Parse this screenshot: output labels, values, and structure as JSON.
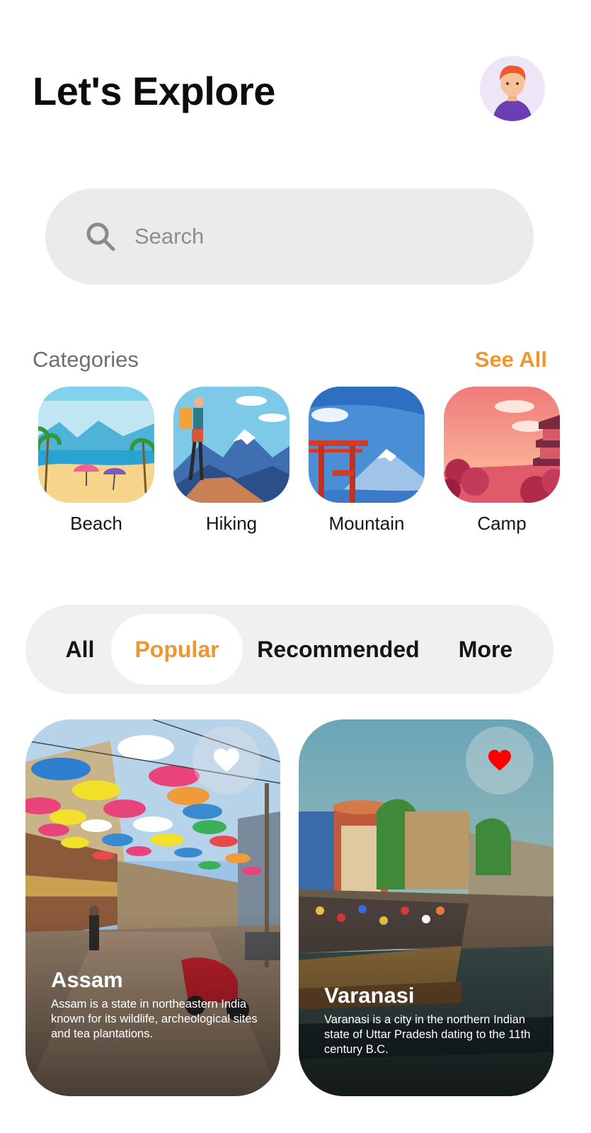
{
  "header": {
    "title": "Let's Explore",
    "avatar_icon": "user-avatar-icon"
  },
  "search": {
    "placeholder": "Search",
    "value": ""
  },
  "categories": {
    "heading": "Categories",
    "see_all": "See All",
    "items": [
      {
        "label": "Beach"
      },
      {
        "label": "Hiking"
      },
      {
        "label": "Mountain"
      },
      {
        "label": "Camp"
      }
    ]
  },
  "tabs": {
    "items": [
      {
        "label": "All"
      },
      {
        "label": "Popular"
      },
      {
        "label": "Recommended"
      },
      {
        "label": "More"
      }
    ],
    "active": "Popular"
  },
  "places": [
    {
      "name": "Assam",
      "description": "Assam is a state in northeastern India known for its wildlife, archeological sites and tea plantations.",
      "favorited": false
    },
    {
      "name": "Varanasi",
      "description": "Varanasi is a city in the northern Indian state of Uttar Pradesh dating to the 11th century B.C.",
      "favorited": true
    }
  ],
  "colors": {
    "accent": "#f0962f",
    "favorite_heart": "#ff0000",
    "search_bg": "#ebebeb",
    "tabs_bg": "#f0f0f0"
  }
}
